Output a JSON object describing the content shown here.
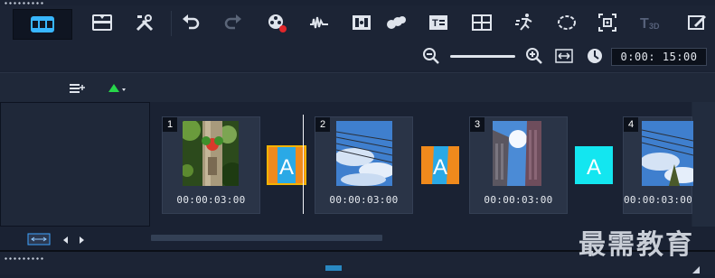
{
  "toolbar": {
    "items": [
      {
        "name": "storyboard-view-icon",
        "active": true
      },
      {
        "name": "timeline-view-icon"
      },
      {
        "name": "tools-icon"
      },
      {
        "name": "undo-icon"
      },
      {
        "name": "redo-icon"
      },
      {
        "name": "record-capture-icon"
      },
      {
        "name": "sound-mixer-icon"
      },
      {
        "name": "auto-music-icon"
      },
      {
        "name": "motion-tracking-icon"
      },
      {
        "name": "subtitle-editor-icon"
      },
      {
        "name": "multi-camera-icon"
      },
      {
        "name": "speed-icon"
      },
      {
        "name": "mask-creator-icon"
      },
      {
        "name": "pan-zoom-icon"
      },
      {
        "name": "title-3d-icon",
        "label": "T3D"
      },
      {
        "name": "painting-creator-icon"
      }
    ]
  },
  "zoom": {
    "timecode": "0:00: 15:00"
  },
  "clips": [
    {
      "number": "1",
      "duration": "00:00:03:00"
    },
    {
      "number": "2",
      "duration": "00:00:03:00"
    },
    {
      "number": "3",
      "duration": "00:00:03:00"
    },
    {
      "number": "4",
      "duration": "00:00:03:00"
    }
  ],
  "transitions": [
    {
      "letter": "A"
    },
    {
      "letter": "A"
    },
    {
      "letter": "A"
    }
  ],
  "watermark": "最需教育",
  "colors": {
    "accent_blue": "#2fb4ff",
    "transition_cyan": "#13e6f0",
    "transition_orange": "#f08a1c",
    "timecode_bg": "#0c111b"
  }
}
